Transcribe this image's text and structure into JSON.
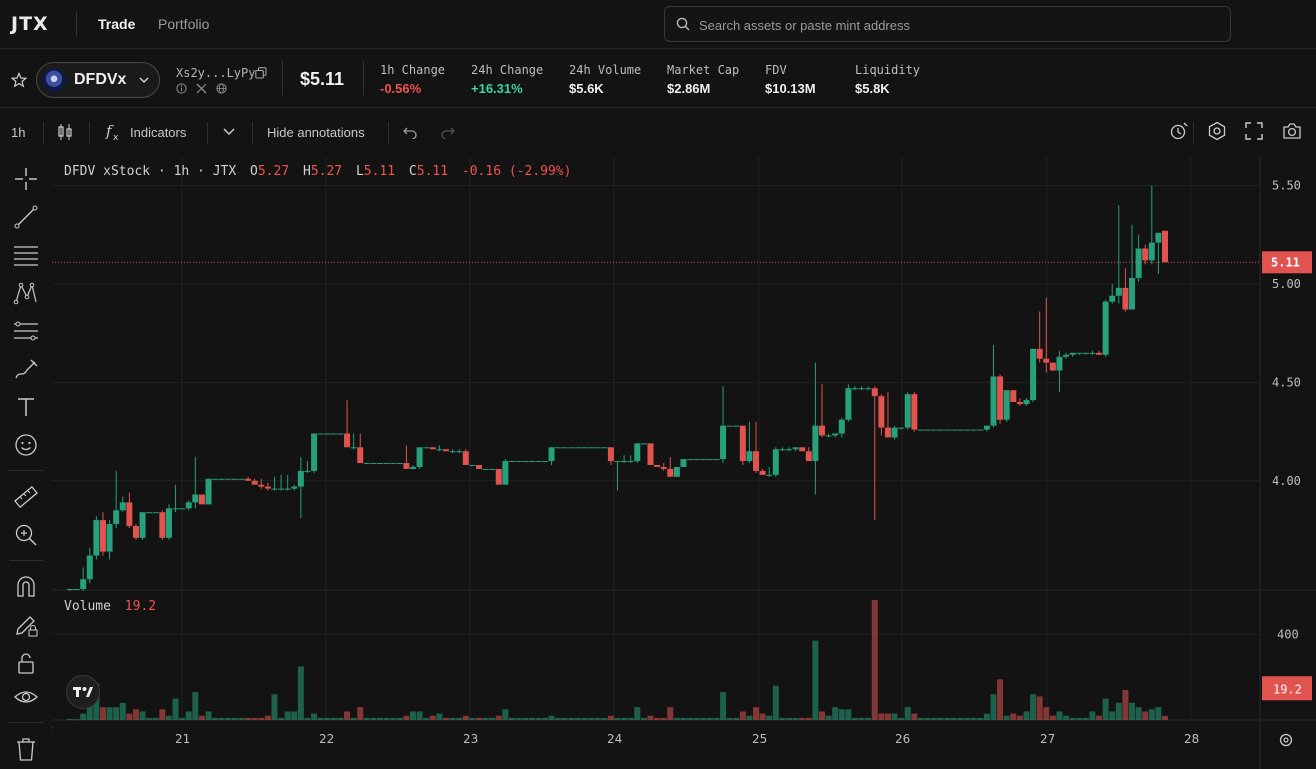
{
  "nav": {
    "logo": "JTX",
    "trade": "Trade",
    "portfolio": "Portfolio"
  },
  "search": {
    "placeholder": "Search assets or paste mint address"
  },
  "token": {
    "symbol": "DFDVx",
    "address": "Xs2y...LyPy",
    "price": "$5.11",
    "stats": [
      {
        "label": "1h Change",
        "value": "-0.56%",
        "tone": "neg"
      },
      {
        "label": "24h Change",
        "value": "+16.31%",
        "tone": "pos"
      },
      {
        "label": "24h Volume",
        "value": "$5.6K",
        "tone": ""
      },
      {
        "label": "Market Cap",
        "value": "$2.86M",
        "tone": ""
      },
      {
        "label": "FDV",
        "value": "$10.13M",
        "tone": ""
      },
      {
        "label": "Liquidity",
        "value": "$5.8K",
        "tone": ""
      }
    ]
  },
  "toolbar": {
    "interval": "1h",
    "indicators": "Indicators",
    "hide_annotations": "Hide annotations"
  },
  "legend": {
    "title": "DFDV xStock · 1h · JTX",
    "o_label": "O",
    "o": "5.27",
    "h_label": "H",
    "h": "5.27",
    "l_label": "L",
    "l": "5.11",
    "c_label": "C",
    "c": "5.11",
    "change": "-0.16 (-2.99%)"
  },
  "volume": {
    "label": "Volume",
    "value": "19.2"
  },
  "colors": {
    "up": "#26a17b",
    "down": "#e0534e",
    "background": "#131313",
    "grid": "#222222"
  },
  "chart_data": {
    "type": "candlestick",
    "x_ticks": [
      "21",
      "22",
      "23",
      "24",
      "25",
      "26",
      "27",
      "28"
    ],
    "y_ticks": [
      "5.50",
      "5.00",
      "4.50",
      "4.00"
    ],
    "y_range": [
      3.45,
      5.65
    ],
    "last_price_label": "5.11",
    "volume_ticks": [
      "400"
    ],
    "volume_range": [
      0,
      560
    ],
    "last_volume_label": "19.2",
    "candles": [
      {
        "o": 3.45,
        "h": 3.45,
        "l": 3.44,
        "c": 3.45,
        "v": 5
      },
      {
        "o": 3.45,
        "h": 3.45,
        "l": 3.45,
        "c": 3.45,
        "v": 4
      },
      {
        "o": 3.45,
        "h": 3.56,
        "l": 3.44,
        "c": 3.5,
        "v": 30
      },
      {
        "o": 3.5,
        "h": 3.66,
        "l": 3.48,
        "c": 3.62,
        "v": 70
      },
      {
        "o": 3.62,
        "h": 3.82,
        "l": 3.6,
        "c": 3.8,
        "v": 170
      },
      {
        "o": 3.8,
        "h": 3.84,
        "l": 3.62,
        "c": 3.64,
        "v": 60
      },
      {
        "o": 3.64,
        "h": 3.8,
        "l": 3.6,
        "c": 3.78,
        "v": 60
      },
      {
        "o": 3.78,
        "h": 4.05,
        "l": 3.76,
        "c": 3.85,
        "v": 60
      },
      {
        "o": 3.85,
        "h": 3.92,
        "l": 3.84,
        "c": 3.89,
        "v": 80
      },
      {
        "o": 3.89,
        "h": 3.94,
        "l": 3.76,
        "c": 3.77,
        "v": 30
      },
      {
        "o": 3.77,
        "h": 3.78,
        "l": 3.7,
        "c": 3.71,
        "v": 50
      },
      {
        "o": 3.71,
        "h": 3.84,
        "l": 3.7,
        "c": 3.84,
        "v": 40
      },
      {
        "o": 3.84,
        "h": 3.84,
        "l": 3.84,
        "c": 3.84,
        "v": 10
      },
      {
        "o": 3.84,
        "h": 3.84,
        "l": 3.84,
        "c": 3.84,
        "v": 10
      },
      {
        "o": 3.84,
        "h": 3.85,
        "l": 3.7,
        "c": 3.71,
        "v": 50
      },
      {
        "o": 3.71,
        "h": 3.88,
        "l": 3.7,
        "c": 3.86,
        "v": 20
      },
      {
        "o": 3.86,
        "h": 3.98,
        "l": 3.84,
        "c": 3.86,
        "v": 100
      },
      {
        "o": 3.86,
        "h": 3.86,
        "l": 3.86,
        "c": 3.86,
        "v": 10
      },
      {
        "o": 3.86,
        "h": 3.9,
        "l": 3.85,
        "c": 3.89,
        "v": 40
      },
      {
        "o": 3.89,
        "h": 4.12,
        "l": 3.86,
        "c": 3.93,
        "v": 130
      },
      {
        "o": 3.93,
        "h": 3.93,
        "l": 3.88,
        "c": 3.88,
        "v": 20
      },
      {
        "o": 3.88,
        "h": 4.01,
        "l": 3.88,
        "c": 4.01,
        "v": 40
      },
      {
        "o": 4.01,
        "h": 4.01,
        "l": 4.01,
        "c": 4.01,
        "v": 10
      },
      {
        "o": 4.01,
        "h": 4.01,
        "l": 4.01,
        "c": 4.01,
        "v": 10
      },
      {
        "o": 4.01,
        "h": 4.01,
        "l": 4.01,
        "c": 4.01,
        "v": 10
      },
      {
        "o": 4.01,
        "h": 4.01,
        "l": 4.01,
        "c": 4.01,
        "v": 10
      },
      {
        "o": 4.01,
        "h": 4.01,
        "l": 4.01,
        "c": 4.01,
        "v": 10
      },
      {
        "o": 4.01,
        "h": 4.02,
        "l": 4.0,
        "c": 4.0,
        "v": 10
      },
      {
        "o": 4.0,
        "h": 4.01,
        "l": 3.98,
        "c": 3.98,
        "v": 10
      },
      {
        "o": 3.98,
        "h": 4.01,
        "l": 3.96,
        "c": 3.97,
        "v": 10
      },
      {
        "o": 3.97,
        "h": 3.99,
        "l": 3.95,
        "c": 3.96,
        "v": 20
      },
      {
        "o": 3.96,
        "h": 4.02,
        "l": 3.95,
        "c": 3.96,
        "v": 120
      },
      {
        "o": 3.96,
        "h": 4.03,
        "l": 3.95,
        "c": 3.96,
        "v": 10
      },
      {
        "o": 3.96,
        "h": 4.03,
        "l": 3.95,
        "c": 3.96,
        "v": 40
      },
      {
        "o": 3.96,
        "h": 3.98,
        "l": 3.95,
        "c": 3.97,
        "v": 40
      },
      {
        "o": 3.97,
        "h": 4.12,
        "l": 3.81,
        "c": 4.05,
        "v": 250
      },
      {
        "o": 4.05,
        "h": 4.1,
        "l": 4.04,
        "c": 4.05,
        "v": 10
      },
      {
        "o": 4.05,
        "h": 4.24,
        "l": 4.04,
        "c": 4.24,
        "v": 30
      },
      {
        "o": 4.24,
        "h": 4.24,
        "l": 4.24,
        "c": 4.24,
        "v": 10
      },
      {
        "o": 4.24,
        "h": 4.24,
        "l": 4.24,
        "c": 4.24,
        "v": 10
      },
      {
        "o": 4.24,
        "h": 4.24,
        "l": 4.24,
        "c": 4.24,
        "v": 10
      },
      {
        "o": 4.24,
        "h": 4.24,
        "l": 4.24,
        "c": 4.24,
        "v": 10
      },
      {
        "o": 4.24,
        "h": 4.41,
        "l": 4.23,
        "c": 4.17,
        "v": 40
      },
      {
        "o": 4.17,
        "h": 4.24,
        "l": 4.16,
        "c": 4.17,
        "v": 10
      },
      {
        "o": 4.17,
        "h": 4.24,
        "l": 4.13,
        "c": 4.09,
        "v": 60
      },
      {
        "o": 4.09,
        "h": 4.09,
        "l": 4.09,
        "c": 4.09,
        "v": 10
      },
      {
        "o": 4.09,
        "h": 4.09,
        "l": 4.09,
        "c": 4.09,
        "v": 10
      },
      {
        "o": 4.09,
        "h": 4.09,
        "l": 4.09,
        "c": 4.09,
        "v": 10
      },
      {
        "o": 4.09,
        "h": 4.09,
        "l": 4.09,
        "c": 4.09,
        "v": 10
      },
      {
        "o": 4.09,
        "h": 4.09,
        "l": 4.09,
        "c": 4.09,
        "v": 10
      },
      {
        "o": 4.09,
        "h": 4.09,
        "l": 4.09,
        "c": 4.09,
        "v": 10
      },
      {
        "o": 4.09,
        "h": 4.18,
        "l": 4.06,
        "c": 4.06,
        "v": 20
      },
      {
        "o": 4.06,
        "h": 4.08,
        "l": 4.06,
        "c": 4.07,
        "v": 40
      },
      {
        "o": 4.07,
        "h": 4.17,
        "l": 4.06,
        "c": 4.17,
        "v": 40
      },
      {
        "o": 4.17,
        "h": 4.17,
        "l": 4.17,
        "c": 4.17,
        "v": 10
      },
      {
        "o": 4.17,
        "h": 4.17,
        "l": 4.16,
        "c": 4.16,
        "v": 20
      },
      {
        "o": 4.16,
        "h": 4.18,
        "l": 4.15,
        "c": 4.16,
        "v": 30
      },
      {
        "o": 4.16,
        "h": 4.16,
        "l": 4.15,
        "c": 4.15,
        "v": 10
      },
      {
        "o": 4.15,
        "h": 4.16,
        "l": 4.14,
        "c": 4.15,
        "v": 10
      },
      {
        "o": 4.15,
        "h": 4.16,
        "l": 4.14,
        "c": 4.15,
        "v": 10
      },
      {
        "o": 4.15,
        "h": 4.16,
        "l": 4.14,
        "c": 4.08,
        "v": 20
      },
      {
        "o": 4.08,
        "h": 4.08,
        "l": 4.08,
        "c": 4.08,
        "v": 10
      },
      {
        "o": 4.08,
        "h": 4.08,
        "l": 4.06,
        "c": 4.06,
        "v": 10
      },
      {
        "o": 4.06,
        "h": 4.06,
        "l": 4.06,
        "c": 4.06,
        "v": 10
      },
      {
        "o": 4.06,
        "h": 4.06,
        "l": 4.06,
        "c": 4.06,
        "v": 10
      },
      {
        "o": 4.06,
        "h": 4.06,
        "l": 3.98,
        "c": 3.98,
        "v": 20
      },
      {
        "o": 3.98,
        "h": 4.11,
        "l": 3.98,
        "c": 4.1,
        "v": 50
      },
      {
        "o": 4.1,
        "h": 4.1,
        "l": 4.1,
        "c": 4.1,
        "v": 10
      },
      {
        "o": 4.1,
        "h": 4.1,
        "l": 4.1,
        "c": 4.1,
        "v": 10
      },
      {
        "o": 4.1,
        "h": 4.1,
        "l": 4.1,
        "c": 4.1,
        "v": 10
      },
      {
        "o": 4.1,
        "h": 4.1,
        "l": 4.1,
        "c": 4.1,
        "v": 10
      },
      {
        "o": 4.1,
        "h": 4.1,
        "l": 4.1,
        "c": 4.1,
        "v": 10
      },
      {
        "o": 4.1,
        "h": 4.1,
        "l": 4.1,
        "c": 4.1,
        "v": 10
      },
      {
        "o": 4.1,
        "h": 4.17,
        "l": 4.08,
        "c": 4.17,
        "v": 20
      },
      {
        "o": 4.17,
        "h": 4.17,
        "l": 4.17,
        "c": 4.17,
        "v": 10
      },
      {
        "o": 4.17,
        "h": 4.17,
        "l": 4.17,
        "c": 4.17,
        "v": 10
      },
      {
        "o": 4.17,
        "h": 4.17,
        "l": 4.17,
        "c": 4.17,
        "v": 10
      },
      {
        "o": 4.17,
        "h": 4.17,
        "l": 4.17,
        "c": 4.17,
        "v": 10
      },
      {
        "o": 4.17,
        "h": 4.17,
        "l": 4.17,
        "c": 4.17,
        "v": 10
      },
      {
        "o": 4.17,
        "h": 4.17,
        "l": 4.17,
        "c": 4.17,
        "v": 10
      },
      {
        "o": 4.17,
        "h": 4.17,
        "l": 4.17,
        "c": 4.17,
        "v": 10
      },
      {
        "o": 4.17,
        "h": 4.17,
        "l": 4.17,
        "c": 4.17,
        "v": 10
      },
      {
        "o": 4.17,
        "h": 4.17,
        "l": 4.08,
        "c": 4.1,
        "v": 20
      },
      {
        "o": 4.1,
        "h": 4.1,
        "l": 3.95,
        "c": 4.1,
        "v": 10
      },
      {
        "o": 4.1,
        "h": 4.13,
        "l": 4.09,
        "c": 4.1,
        "v": 10
      },
      {
        "o": 4.1,
        "h": 4.13,
        "l": 4.09,
        "c": 4.1,
        "v": 10
      },
      {
        "o": 4.1,
        "h": 4.19,
        "l": 4.09,
        "c": 4.19,
        "v": 60
      },
      {
        "o": 4.19,
        "h": 4.19,
        "l": 4.19,
        "c": 4.19,
        "v": 10
      },
      {
        "o": 4.19,
        "h": 4.19,
        "l": 4.19,
        "c": 4.08,
        "v": 20
      },
      {
        "o": 4.08,
        "h": 4.08,
        "l": 4.07,
        "c": 4.07,
        "v": 10
      },
      {
        "o": 4.07,
        "h": 4.09,
        "l": 4.05,
        "c": 4.06,
        "v": 10
      },
      {
        "o": 4.06,
        "h": 4.12,
        "l": 4.02,
        "c": 4.02,
        "v": 60
      },
      {
        "o": 4.02,
        "h": 4.07,
        "l": 4.02,
        "c": 4.07,
        "v": 10
      },
      {
        "o": 4.07,
        "h": 4.11,
        "l": 4.07,
        "c": 4.11,
        "v": 10
      },
      {
        "o": 4.11,
        "h": 4.11,
        "l": 4.11,
        "c": 4.11,
        "v": 10
      },
      {
        "o": 4.11,
        "h": 4.11,
        "l": 4.11,
        "c": 4.11,
        "v": 10
      },
      {
        "o": 4.11,
        "h": 4.11,
        "l": 4.11,
        "c": 4.11,
        "v": 10
      },
      {
        "o": 4.11,
        "h": 4.11,
        "l": 4.11,
        "c": 4.11,
        "v": 10
      },
      {
        "o": 4.11,
        "h": 4.11,
        "l": 4.11,
        "c": 4.11,
        "v": 10
      },
      {
        "o": 4.11,
        "h": 4.48,
        "l": 4.09,
        "c": 4.28,
        "v": 130
      },
      {
        "o": 4.28,
        "h": 4.28,
        "l": 4.28,
        "c": 4.28,
        "v": 10
      },
      {
        "o": 4.28,
        "h": 4.28,
        "l": 4.28,
        "c": 4.28,
        "v": 10
      },
      {
        "o": 4.28,
        "h": 4.28,
        "l": 4.08,
        "c": 4.1,
        "v": 40
      },
      {
        "o": 4.1,
        "h": 4.3,
        "l": 4.09,
        "c": 4.15,
        "v": 20
      },
      {
        "o": 4.15,
        "h": 4.3,
        "l": 4.04,
        "c": 4.05,
        "v": 60
      },
      {
        "o": 4.05,
        "h": 4.06,
        "l": 4.03,
        "c": 4.03,
        "v": 30
      },
      {
        "o": 4.03,
        "h": 4.07,
        "l": 4.02,
        "c": 4.03,
        "v": 20
      },
      {
        "o": 4.03,
        "h": 4.17,
        "l": 4.02,
        "c": 4.16,
        "v": 160
      },
      {
        "o": 4.16,
        "h": 4.17,
        "l": 4.15,
        "c": 4.16,
        "v": 10
      },
      {
        "o": 4.16,
        "h": 4.17,
        "l": 4.15,
        "c": 4.16,
        "v": 10
      },
      {
        "o": 4.16,
        "h": 4.17,
        "l": 4.15,
        "c": 4.17,
        "v": 10
      },
      {
        "o": 4.17,
        "h": 4.17,
        "l": 4.15,
        "c": 4.15,
        "v": 10
      },
      {
        "o": 4.15,
        "h": 4.17,
        "l": 4.1,
        "c": 4.1,
        "v": 10
      },
      {
        "o": 4.1,
        "h": 4.6,
        "l": 3.93,
        "c": 4.28,
        "v": 370
      },
      {
        "o": 4.28,
        "h": 4.49,
        "l": 4.22,
        "c": 4.23,
        "v": 40
      },
      {
        "o": 4.23,
        "h": 4.24,
        "l": 4.22,
        "c": 4.23,
        "v": 20
      },
      {
        "o": 4.23,
        "h": 4.24,
        "l": 4.22,
        "c": 4.24,
        "v": 60
      },
      {
        "o": 4.24,
        "h": 4.32,
        "l": 4.22,
        "c": 4.31,
        "v": 50
      },
      {
        "o": 4.31,
        "h": 4.49,
        "l": 4.3,
        "c": 4.47,
        "v": 50
      },
      {
        "o": 4.47,
        "h": 4.48,
        "l": 4.46,
        "c": 4.47,
        "v": 10
      },
      {
        "o": 4.47,
        "h": 4.48,
        "l": 4.46,
        "c": 4.47,
        "v": 10
      },
      {
        "o": 4.47,
        "h": 4.48,
        "l": 4.46,
        "c": 4.47,
        "v": 10
      },
      {
        "o": 4.47,
        "h": 4.48,
        "l": 3.8,
        "c": 4.43,
        "v": 560
      },
      {
        "o": 4.43,
        "h": 4.44,
        "l": 4.23,
        "c": 4.27,
        "v": 30
      },
      {
        "o": 4.27,
        "h": 4.45,
        "l": 4.22,
        "c": 4.22,
        "v": 30
      },
      {
        "o": 4.22,
        "h": 4.28,
        "l": 4.21,
        "c": 4.27,
        "v": 30
      },
      {
        "o": 4.27,
        "h": 4.27,
        "l": 4.26,
        "c": 4.27,
        "v": 10
      },
      {
        "o": 4.27,
        "h": 4.45,
        "l": 4.26,
        "c": 4.44,
        "v": 60
      },
      {
        "o": 4.44,
        "h": 4.45,
        "l": 4.25,
        "c": 4.26,
        "v": 30
      },
      {
        "o": 4.26,
        "h": 4.26,
        "l": 4.26,
        "c": 4.26,
        "v": 10
      },
      {
        "o": 4.26,
        "h": 4.26,
        "l": 4.26,
        "c": 4.26,
        "v": 10
      },
      {
        "o": 4.26,
        "h": 4.26,
        "l": 4.26,
        "c": 4.26,
        "v": 10
      },
      {
        "o": 4.26,
        "h": 4.26,
        "l": 4.26,
        "c": 4.26,
        "v": 10
      },
      {
        "o": 4.26,
        "h": 4.26,
        "l": 4.26,
        "c": 4.26,
        "v": 10
      },
      {
        "o": 4.26,
        "h": 4.26,
        "l": 4.26,
        "c": 4.26,
        "v": 10
      },
      {
        "o": 4.26,
        "h": 4.26,
        "l": 4.26,
        "c": 4.26,
        "v": 10
      },
      {
        "o": 4.26,
        "h": 4.26,
        "l": 4.26,
        "c": 4.26,
        "v": 10
      },
      {
        "o": 4.26,
        "h": 4.26,
        "l": 4.26,
        "c": 4.26,
        "v": 10
      },
      {
        "o": 4.26,
        "h": 4.26,
        "l": 4.26,
        "c": 4.26,
        "v": 10
      },
      {
        "o": 4.26,
        "h": 4.28,
        "l": 4.25,
        "c": 4.28,
        "v": 30
      },
      {
        "o": 4.28,
        "h": 4.69,
        "l": 4.27,
        "c": 4.53,
        "v": 120
      },
      {
        "o": 4.53,
        "h": 4.54,
        "l": 4.29,
        "c": 4.31,
        "v": 190
      },
      {
        "o": 4.31,
        "h": 4.46,
        "l": 4.3,
        "c": 4.46,
        "v": 20
      },
      {
        "o": 4.46,
        "h": 4.46,
        "l": 4.4,
        "c": 4.4,
        "v": 30
      },
      {
        "o": 4.4,
        "h": 4.42,
        "l": 4.38,
        "c": 4.39,
        "v": 20
      },
      {
        "o": 4.39,
        "h": 4.42,
        "l": 4.38,
        "c": 4.41,
        "v": 40
      },
      {
        "o": 4.41,
        "h": 4.67,
        "l": 4.4,
        "c": 4.67,
        "v": 120
      },
      {
        "o": 4.67,
        "h": 4.86,
        "l": 4.6,
        "c": 4.62,
        "v": 110
      },
      {
        "o": 4.62,
        "h": 4.93,
        "l": 4.55,
        "c": 4.6,
        "v": 60
      },
      {
        "o": 4.6,
        "h": 4.6,
        "l": 4.56,
        "c": 4.56,
        "v": 20
      },
      {
        "o": 4.56,
        "h": 4.66,
        "l": 4.45,
        "c": 4.63,
        "v": 40
      },
      {
        "o": 4.63,
        "h": 4.65,
        "l": 4.62,
        "c": 4.64,
        "v": 20
      },
      {
        "o": 4.64,
        "h": 4.65,
        "l": 4.63,
        "c": 4.65,
        "v": 10
      },
      {
        "o": 4.65,
        "h": 4.65,
        "l": 4.64,
        "c": 4.65,
        "v": 10
      },
      {
        "o": 4.65,
        "h": 4.65,
        "l": 4.64,
        "c": 4.65,
        "v": 10
      },
      {
        "o": 4.65,
        "h": 4.66,
        "l": 4.64,
        "c": 4.65,
        "v": 40
      },
      {
        "o": 4.65,
        "h": 4.66,
        "l": 4.64,
        "c": 4.64,
        "v": 20
      },
      {
        "o": 4.64,
        "h": 4.92,
        "l": 4.63,
        "c": 4.91,
        "v": 100
      },
      {
        "o": 4.91,
        "h": 5.0,
        "l": 4.9,
        "c": 4.94,
        "v": 40
      },
      {
        "o": 4.94,
        "h": 5.4,
        "l": 4.9,
        "c": 4.98,
        "v": 80
      },
      {
        "o": 4.98,
        "h": 5.08,
        "l": 4.86,
        "c": 4.87,
        "v": 140
      },
      {
        "o": 4.87,
        "h": 5.3,
        "l": 4.9,
        "c": 5.03,
        "v": 80
      },
      {
        "o": 5.03,
        "h": 5.25,
        "l": 5.01,
        "c": 5.18,
        "v": 60
      },
      {
        "o": 5.18,
        "h": 5.2,
        "l": 5.1,
        "c": 5.12,
        "v": 40
      },
      {
        "o": 5.12,
        "h": 5.5,
        "l": 5.1,
        "c": 5.21,
        "v": 50
      },
      {
        "o": 5.21,
        "h": 5.25,
        "l": 5.05,
        "c": 5.26,
        "v": 60
      },
      {
        "o": 5.27,
        "h": 5.27,
        "l": 5.11,
        "c": 5.11,
        "v": 19.2
      }
    ]
  }
}
